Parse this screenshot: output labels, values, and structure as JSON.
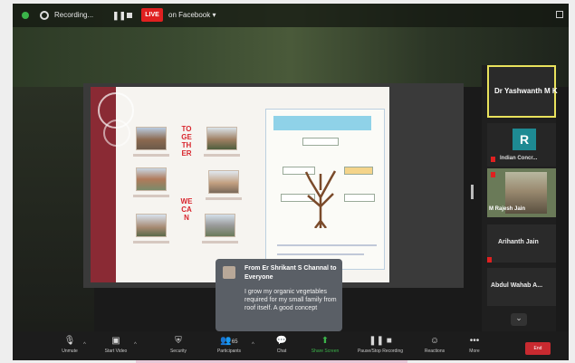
{
  "topbar": {
    "recording_label": "Recording...",
    "pause_glyph": "❚❚",
    "live_badge": "LIVE",
    "live_destination": "on Facebook ▾"
  },
  "slide": {
    "vertical_text_top": "TOGETHER",
    "vertical_text_bottom": "WE CAN"
  },
  "participants": [
    {
      "name": "Dr Yashwanth M K",
      "type": "name-only",
      "active_speaker": true
    },
    {
      "name": "Indian Concr...",
      "avatar_letter": "R",
      "avatar_color": "#1e8a93",
      "muted": true
    },
    {
      "name": "M Rajesh Jain",
      "type": "video",
      "muted": true
    },
    {
      "name": "Arihanth Jain",
      "type": "name-only"
    },
    {
      "name": "Abdul Wahab A...",
      "type": "name-only",
      "muted": true
    }
  ],
  "chat_popup": {
    "from": "From Er Shrikant S Channal to Everyone",
    "message": "I grow my organic vegetables required for my small family from roof itself. A good concept"
  },
  "toolbar": {
    "items": [
      {
        "label": "Unmute",
        "icon": "mic-muted-icon",
        "glyph": "🎙"
      },
      {
        "label": "Start Video",
        "icon": "video-off-icon",
        "glyph": "▣"
      },
      {
        "label": "Security",
        "icon": "shield-icon",
        "glyph": "⛨"
      },
      {
        "label": "Participants",
        "icon": "participants-icon",
        "glyph": "👥",
        "count": "65"
      },
      {
        "label": "Chat",
        "icon": "chat-icon",
        "glyph": "💬"
      },
      {
        "label": "Share Screen",
        "icon": "share-screen-icon",
        "glyph": "⬆"
      },
      {
        "label": "Pause/Stop Recording",
        "icon": "pause-stop-icon",
        "glyph": "❚❚ ■"
      },
      {
        "label": "Reactions",
        "icon": "reactions-icon",
        "glyph": "☺"
      },
      {
        "label": "More",
        "icon": "more-icon",
        "glyph": "•••"
      }
    ],
    "end_label": "End"
  },
  "colors": {
    "live_red": "#e02020",
    "active_speaker_border": "#e9e25c",
    "share_screen_green": "#3bb34a",
    "recording_green": "#3bb34a"
  }
}
